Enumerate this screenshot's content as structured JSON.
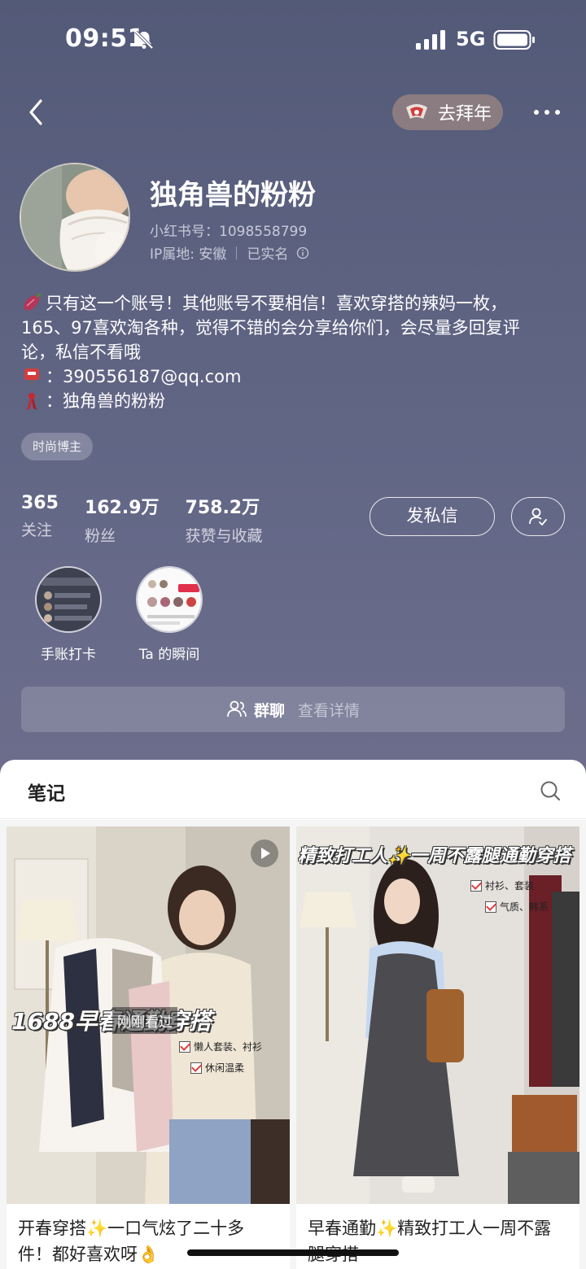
{
  "status_bar": {
    "time": "09:51",
    "network": "5G",
    "icons": [
      "mute-icon",
      "signal-icon",
      "battery-icon"
    ]
  },
  "header": {
    "back_icon": "chevron-left-icon",
    "newyear_label": "去拜年",
    "more_icon": "more-dots-icon"
  },
  "profile": {
    "name": "独角兽的粉粉",
    "id_label": "小红书号：1098558799",
    "ip_label": "IP属地: 安徽",
    "verified_label": "已实名"
  },
  "bio": {
    "line1": "只有这一个账号！其他账号不要相信！喜欢穿搭的辣妈一枚，",
    "line2": "165、97喜欢淘各种，觉得不错的会分享给你们，会尽量多回复评",
    "line3": "论，私信不看哦",
    "email": "：390556187@qq.com",
    "alt_account": "：独角兽的粉粉"
  },
  "tag": "时尚博主",
  "stats": [
    {
      "value": "365",
      "label": "关注"
    },
    {
      "value": "162.9万",
      "label": "粉丝"
    },
    {
      "value": "758.2万",
      "label": "获赞与收藏"
    }
  ],
  "actions": {
    "message_label": "发私信",
    "follow_icon": "followed-user-icon"
  },
  "collections": [
    {
      "label": "手账打卡"
    },
    {
      "label": "Ta 的瞬间"
    }
  ],
  "group_chat": {
    "label": "群聊",
    "detail": "查看详情"
  },
  "notes": {
    "tab_label": "笔记",
    "items": [
      {
        "title": "开春穿搭✨一口气炫了二十多件！都好喜欢呀👌",
        "overlay": "1688早春通勤穿搭",
        "viewed": "刚刚看过",
        "checks": [
          "懒人套装、衬衫",
          "休闲温柔"
        ],
        "is_video": true
      },
      {
        "title": "早春通勤✨精致打工人一周不露腿穿搭",
        "overlay": "精致打工人✨一周不露腿通勤穿搭",
        "checks": [
          "衬衫、套装",
          "气质、韩系"
        ],
        "is_video": false
      }
    ]
  }
}
